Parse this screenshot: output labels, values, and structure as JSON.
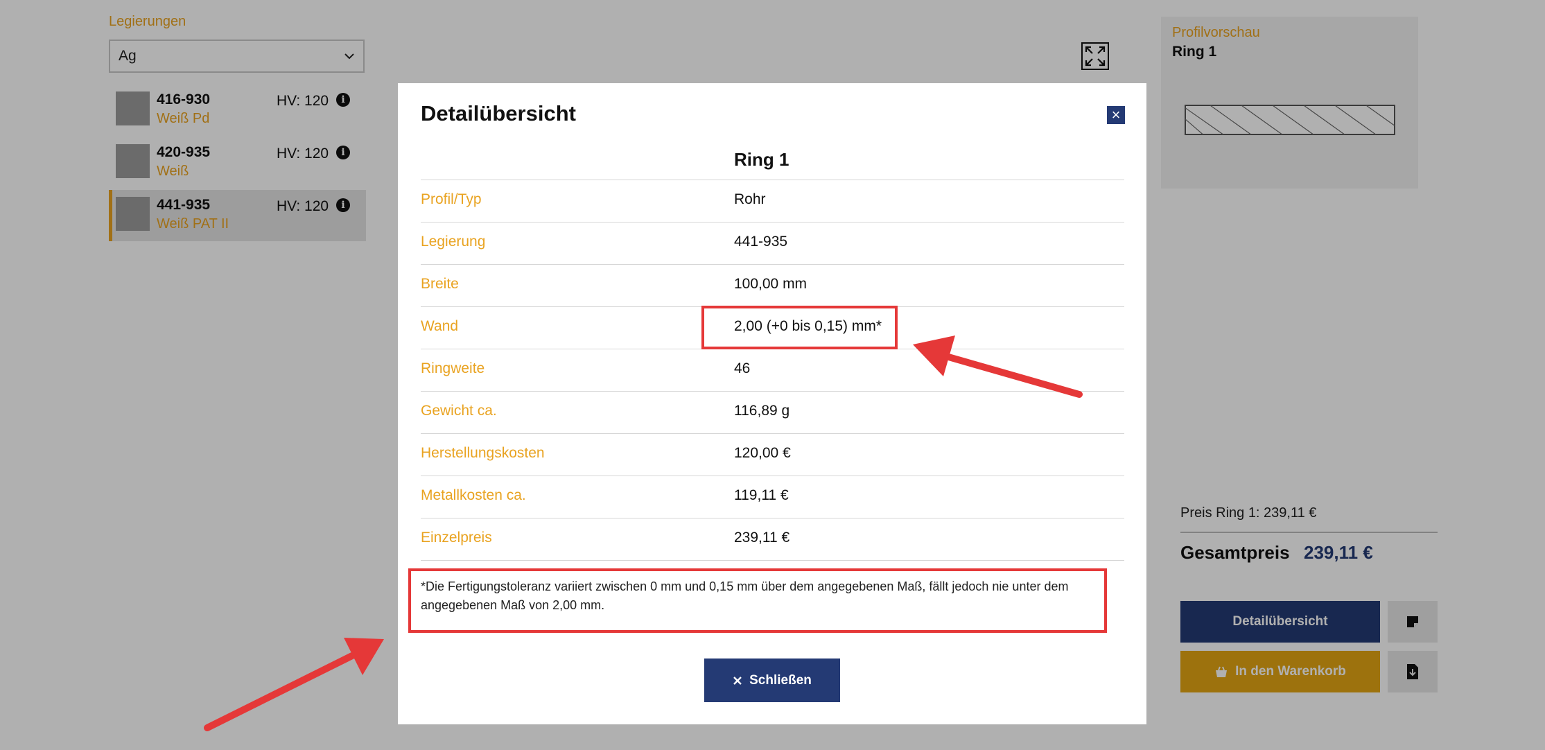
{
  "colors": {
    "accent": "#e9a321",
    "navy": "#243a74",
    "gold": "#e4a513",
    "annotation": "#e53838"
  },
  "alloys": {
    "label": "Legierungen",
    "selected_value": "Ag",
    "items": [
      {
        "code": "416-930",
        "name": "Weiß Pd",
        "hv": "HV: 120"
      },
      {
        "code": "420-935",
        "name": "Weiß",
        "hv": "HV: 120"
      },
      {
        "code": "441-935",
        "name": "Weiß PAT II",
        "hv": "HV: 120"
      }
    ]
  },
  "preview": {
    "label": "Profilvorschau",
    "ring": "Ring 1"
  },
  "pricing": {
    "ring_price": "Preis Ring 1: 239,11 €",
    "total_label": "Gesamtpreis",
    "total_value": "239,11 €",
    "detail_button": "Detailübersicht",
    "cart_button": "In den Warenkorb"
  },
  "modal": {
    "title": "Detailübersicht",
    "column_heading": "Ring 1",
    "rows": [
      {
        "key": "Profil/Typ",
        "value": "Rohr"
      },
      {
        "key": "Legierung",
        "value": "441-935"
      },
      {
        "key": "Breite",
        "value": "100,00 mm"
      },
      {
        "key": "Wand",
        "value": "2,00 (+0 bis 0,15) mm*"
      },
      {
        "key": "Ringweite",
        "value": "46"
      },
      {
        "key": "Gewicht ca.",
        "value": "116,89 g"
      },
      {
        "key": "Herstellungskosten",
        "value": "120,00 €"
      },
      {
        "key": "Metallkosten ca.",
        "value": "119,11 €"
      },
      {
        "key": "Einzelpreis",
        "value": "239,11 €"
      }
    ],
    "footnote": "*Die Fertigungstoleranz variiert zwischen 0 mm und 0,15 mm über dem angegebenen Maß, fällt jedoch nie unter dem angegebenen Maß von 2,00 mm.",
    "close_button": "Schließen"
  }
}
